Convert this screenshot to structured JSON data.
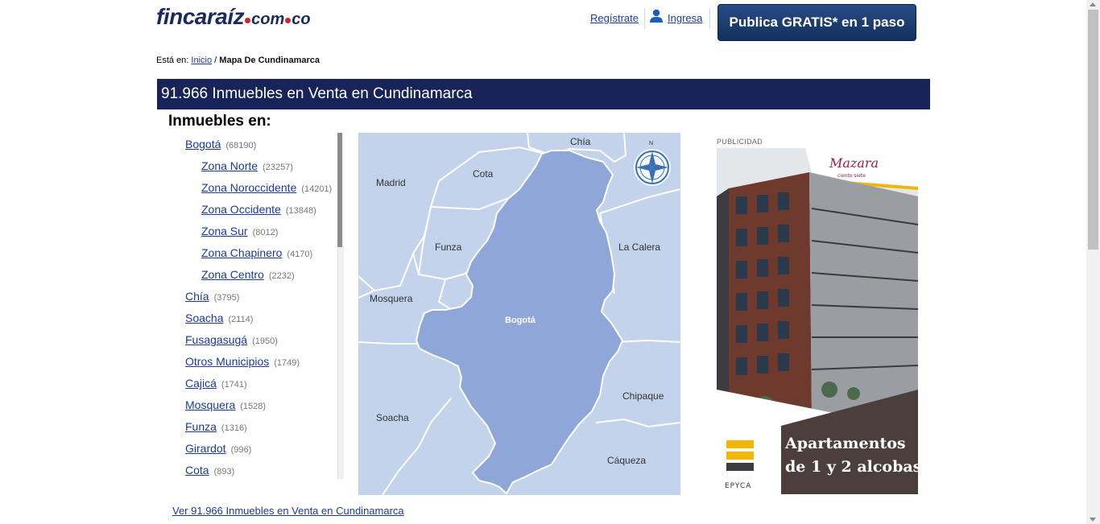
{
  "header": {
    "logo_main": "fincaraíz",
    "logo_tld": "com",
    "logo_tld2": "co",
    "register_label": "Regístrate",
    "login_label": "Ingresa",
    "cta_label": "Publica GRATIS* en 1 paso"
  },
  "breadcrumb": {
    "prefix": "Está en:",
    "home": "Inicio",
    "separator": "/",
    "current": "Mapa De Cundinamarca"
  },
  "banner_title": "91.966 Inmuebles en Venta en Cundinamarca",
  "section_title": "Inmuebles en:",
  "locations": [
    {
      "name": "Bogotá",
      "count": "(68190)"
    },
    {
      "name": "Zona Norte",
      "count": "(23257)"
    },
    {
      "name": "Zona Noroccidente",
      "count": "(14201)"
    },
    {
      "name": "Zona Occidente",
      "count": "(13848)"
    },
    {
      "name": "Zona Sur",
      "count": "(8012)"
    },
    {
      "name": "Zona Chapinero",
      "count": "(4170)"
    },
    {
      "name": "Zona Centro",
      "count": "(2232)"
    },
    {
      "name": "Chía",
      "count": "(3795)"
    },
    {
      "name": "Soacha",
      "count": "(2114)"
    },
    {
      "name": "Fusagasugá",
      "count": "(1950)"
    },
    {
      "name": "Otros Municipios",
      "count": "(1749)"
    },
    {
      "name": "Cajicá",
      "count": "(1741)"
    },
    {
      "name": "Mosquera",
      "count": "(1528)"
    },
    {
      "name": "Funza",
      "count": "(1316)"
    },
    {
      "name": "Girardot",
      "count": "(996)"
    },
    {
      "name": "Cota",
      "count": "(893)"
    }
  ],
  "map": {
    "labels": {
      "chia": "Chía",
      "cota": "Cota",
      "madrid": "Madrid",
      "funza": "Funza",
      "la_calera": "La Calera",
      "mosquera": "Mosquera",
      "bogota": "Bogotá",
      "chipaque": "Chipaque",
      "soacha": "Soacha",
      "caqueza": "Cáqueza"
    },
    "compass_label": "N",
    "colors": {
      "background": "#c3d3ec",
      "highlight": "#8fa6d8",
      "border": "#ffffff"
    }
  },
  "ad": {
    "label": "PUBLICIDAD",
    "brand": "Mazara",
    "brand_sub": "ciento siete",
    "headline_1": "Apartamentos",
    "headline_2": "de 1 y 2 alcobas",
    "developer": "EPYCA"
  },
  "footer_link": "Ver 91.966 Inmuebles en Venta en Cundinamarca",
  "colors": {
    "banner": "#182459",
    "link": "#1a3aa0",
    "cta": "#1d3d72"
  }
}
